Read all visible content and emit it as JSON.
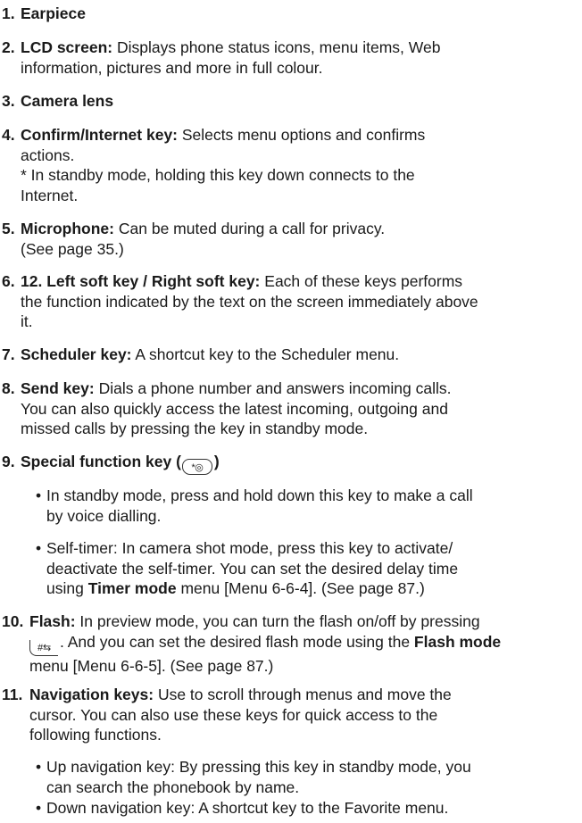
{
  "items": [
    {
      "num": "1.",
      "title": "Earpiece"
    },
    {
      "num": "2.",
      "title": "LCD screen:",
      "lines": [
        "Displays phone status icons, menu items, Web",
        "information, pictures and more in full colour."
      ]
    },
    {
      "num": "3.",
      "title": "Camera lens"
    },
    {
      "num": "4.",
      "title": "Confirm/Internet key:",
      "lines": [
        "Selects menu options and confirms",
        "actions.",
        "* In standby mode, holding this key down connects to the",
        "Internet."
      ]
    },
    {
      "num": "5.",
      "title": "Microphone:",
      "lines": [
        "Can be muted during a call for privacy.",
        "(See page 35.)"
      ]
    },
    {
      "num": "6.",
      "title": "12. Left soft key / Right soft key:",
      "lines": [
        "Each of these keys performs",
        "the function indicated by the text on the screen immediately above",
        "it."
      ]
    },
    {
      "num": "7.",
      "title": "Scheduler key:",
      "lines": [
        "A shortcut key to the Scheduler menu."
      ]
    },
    {
      "num": "8.",
      "title": "Send key:",
      "lines": [
        "Dials a phone number and answers incoming calls.",
        "You can also quickly access the latest incoming, outgoing and",
        "missed calls by pressing the key in standby mode."
      ]
    },
    {
      "num": "9.",
      "title": "Special function key (",
      "title_end": ")",
      "key_icon": "star-key-icon",
      "key_label": "*◎"
    },
    {
      "num": "10.",
      "title": "Flash:",
      "lines": [
        "In preview mode, you can turn the flash on/off by pressing",
        "",
        "menu [Menu 6-6-5]. (See page 87.)"
      ],
      "line2_after_icon": ". And you can set the desired flash mode using the ",
      "line2_bold": "Flash mode",
      "key_icon": "hash-key-icon",
      "key_label": "#⇆"
    },
    {
      "num": "11.",
      "title": "Navigation keys:",
      "lines": [
        "Use to scroll through menus and move the",
        "cursor. You can also use these keys for quick access to the",
        "following functions."
      ]
    }
  ],
  "bullets9": [
    {
      "lines": [
        "In standby mode, press and hold down this key to make a call",
        "by voice dialling."
      ]
    },
    {
      "lines": [
        "Self-timer: In camera shot mode, press this key to activate/",
        "deactivate the self-timer. You can set the desired delay time",
        "using "
      ],
      "bold": "Timer mode",
      "after_bold": " menu [Menu 6-6-4]. (See page 87.)"
    }
  ],
  "bullets11": [
    {
      "lines": [
        "Up navigation key: By pressing this key in standby mode, you",
        "can search the phonebook by name."
      ]
    },
    {
      "lines": [
        "Down navigation key: A shortcut key to the Favorite menu."
      ]
    }
  ],
  "bullet_char": "•"
}
